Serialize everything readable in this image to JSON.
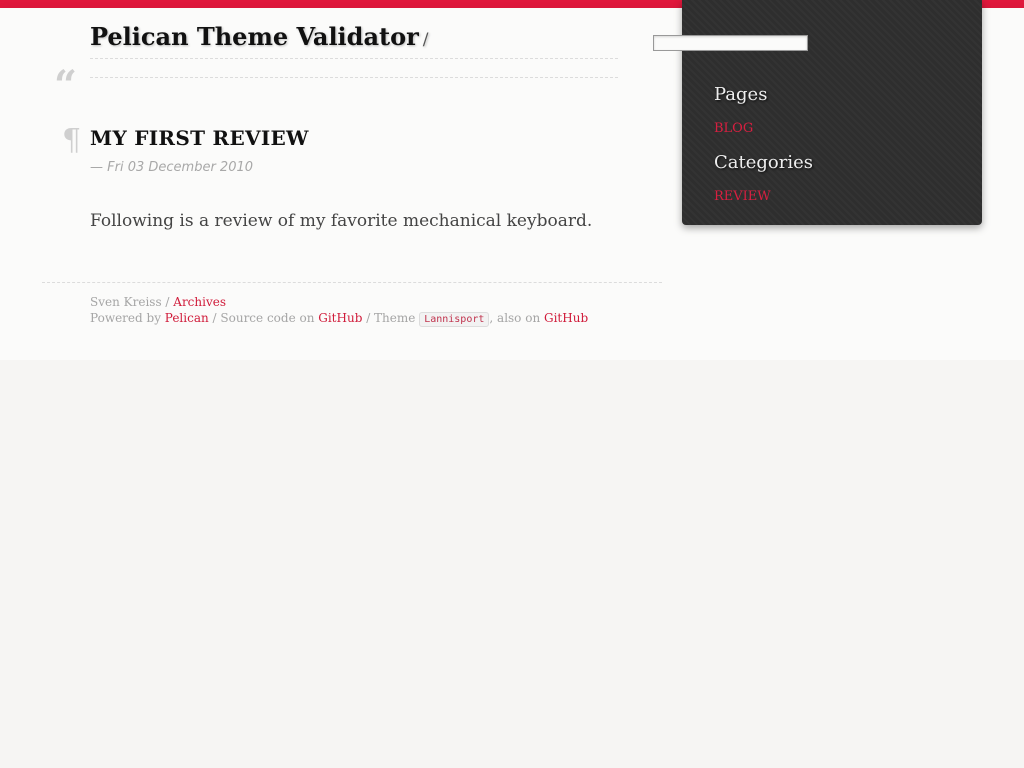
{
  "site": {
    "title": "Pelican Theme Validator",
    "title_separator": "/"
  },
  "search": {
    "value": "",
    "placeholder": ""
  },
  "article": {
    "quote_mark": "“",
    "pilcrow": "¶",
    "title": "MY FIRST REVIEW",
    "date": "— Fri 03 December 2010",
    "body": "Following is a review of my favorite mechanical keyboard."
  },
  "sidebar": {
    "pages_heading": "Pages",
    "pages": [
      {
        "label": "BLOG"
      }
    ],
    "categories_heading": "Categories",
    "categories": [
      {
        "label": "REVIEW"
      }
    ]
  },
  "footer": {
    "author": "Sven Kreiss",
    "separator": " / ",
    "archives_link": "Archives",
    "powered_by": "Powered by ",
    "pelican_link": "Pelican",
    "source_code_text": " / Source code on ",
    "github_link_1": "GitHub",
    "theme_text": " / Theme ",
    "theme_name": "Lannisport",
    "also_on_text": ", also on ",
    "github_link_2": "GitHub"
  },
  "colors": {
    "accent": "#e0183c",
    "sidebar_background": "#2e2e2e",
    "page_background": "#f7f6f4"
  }
}
